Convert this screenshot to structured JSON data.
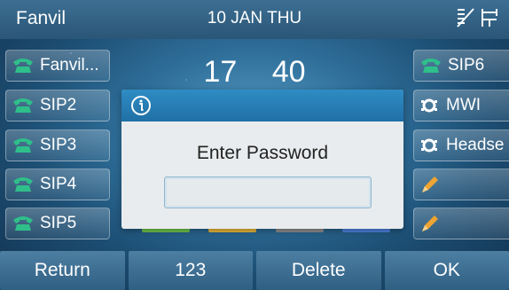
{
  "status_bar": {
    "brand": "Fanvil",
    "date": "10 JAN THU",
    "icons": [
      "network-icon",
      "lan-icon"
    ]
  },
  "clock": {
    "hour": "17",
    "minute": "40"
  },
  "left_keys": [
    {
      "label": "Fanvil...",
      "icon": "phone-icon"
    },
    {
      "label": "SIP2",
      "icon": "phone-icon"
    },
    {
      "label": "SIP3",
      "icon": "phone-icon"
    },
    {
      "label": "SIP4",
      "icon": "phone-icon"
    },
    {
      "label": "SIP5",
      "icon": "phone-icon"
    }
  ],
  "right_keys": [
    {
      "label": "SIP6",
      "icon": "phone-icon"
    },
    {
      "label": "MWI",
      "icon": "voicemail-icon"
    },
    {
      "label": "Headse",
      "icon": "voicemail-icon"
    },
    {
      "label": "",
      "icon": "pencil-icon"
    },
    {
      "label": "",
      "icon": "pencil-icon"
    }
  ],
  "dialog": {
    "icon": "info-icon",
    "message": "Enter Password",
    "password_value": ""
  },
  "softkeys": [
    "Return",
    "123",
    "Delete",
    "OK"
  ],
  "colors": {
    "phone_icon": "#2fbf8a",
    "dialog_header": "#2f8cc4",
    "underbars": [
      "#6cc04a",
      "#e4b43a",
      "#8a8a8a",
      "#4a7fd8"
    ]
  }
}
